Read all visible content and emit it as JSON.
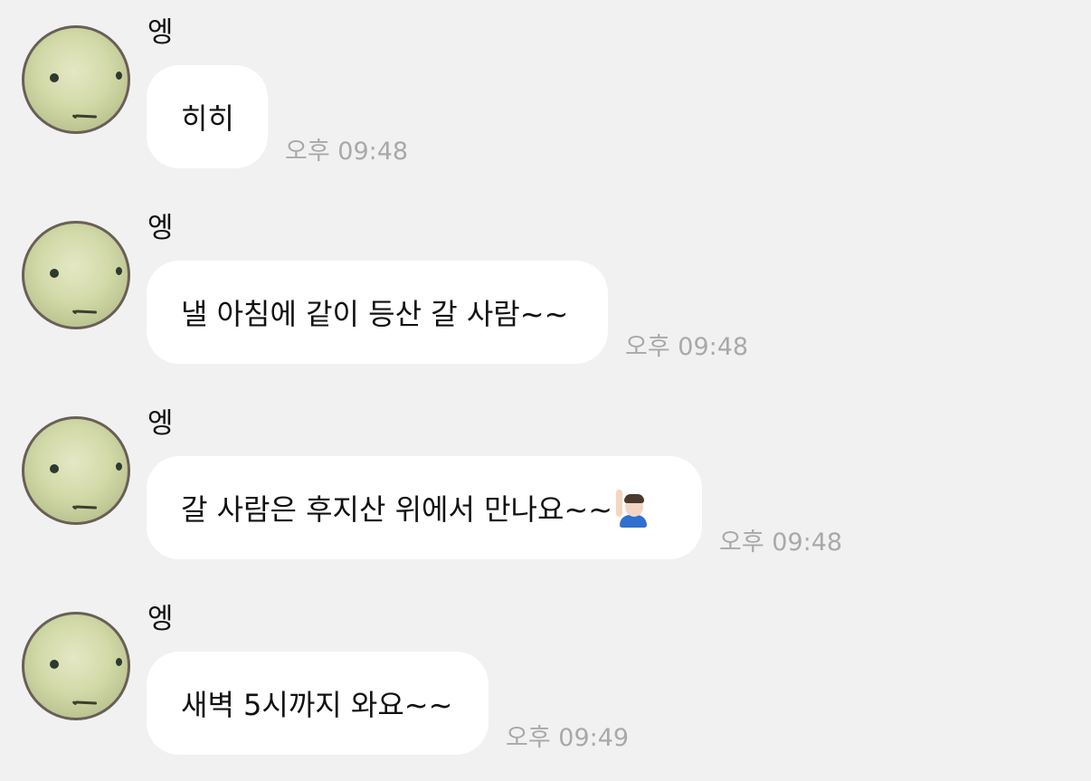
{
  "messages": [
    {
      "sender": "엥",
      "text": "히히",
      "time": "오후 09:48",
      "emoji": ""
    },
    {
      "sender": "엥",
      "text": "낼 아침에 같이 등산 갈 사람~~",
      "time": "오후 09:48",
      "emoji": ""
    },
    {
      "sender": "엥",
      "text": "갈 사람은 후지산 위에서 만나요~~",
      "time": "오후 09:48",
      "emoji": "person-raising-hand-emoji"
    },
    {
      "sender": "엥",
      "text": "새벽 5시까지 와요~~",
      "time": "오후 09:49",
      "emoji": ""
    }
  ],
  "colors": {
    "background": "#f1f1f1",
    "bubble": "#ffffff",
    "timestamp": "#a9a9a9"
  }
}
